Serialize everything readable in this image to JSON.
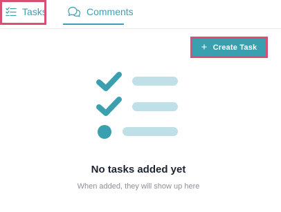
{
  "tabs": [
    {
      "label": "Tasks",
      "icon": "task-list-icon",
      "active": true
    },
    {
      "label": "Comments",
      "icon": "comments-icon",
      "active": false
    }
  ],
  "toolbar": {
    "create_label": "Create Task",
    "create_icon": "plus-icon"
  },
  "empty_state": {
    "title": "No tasks added yet",
    "subtitle": "When added, they will show up here",
    "illustration": "empty-checklist-illustration"
  },
  "colors": {
    "accent": "#3aa0b0",
    "highlight": "#d94f73",
    "illustration_bar": "#bfe0e6",
    "subtitle": "#8a9098"
  }
}
